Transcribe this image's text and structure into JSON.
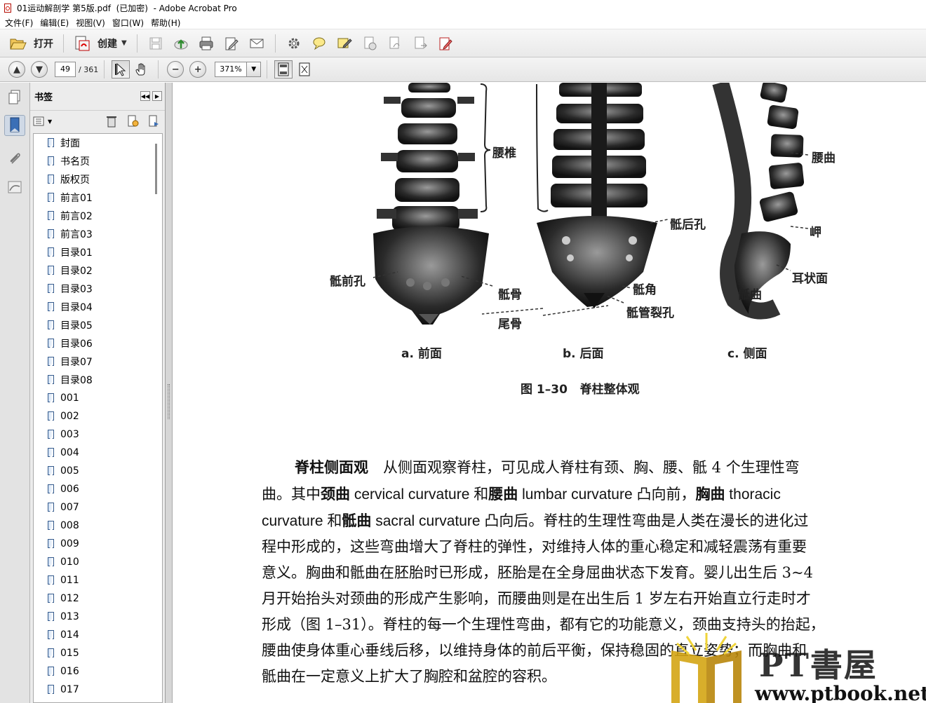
{
  "window": {
    "title": "01运动解剖学 第5版.pdf  (已加密)  - Adobe Acrobat Pro"
  },
  "menu": [
    "文件(F)",
    "编辑(E)",
    "视图(V)",
    "窗口(W)",
    "帮助(H)"
  ],
  "toolbar": {
    "open_label": "打开",
    "create_label": "创建",
    "page_current": "49",
    "page_total": "/ 361",
    "zoom": "371%"
  },
  "bookmarks": {
    "title": "书签",
    "items": [
      "封面",
      "书名页",
      "版权页",
      "前言01",
      "前言02",
      "前言03",
      "目录01",
      "目录02",
      "目录03",
      "目录04",
      "目录05",
      "目录06",
      "目录07",
      "目录08",
      "001",
      "002",
      "003",
      "004",
      "005",
      "006",
      "007",
      "008",
      "009",
      "010",
      "011",
      "012",
      "013",
      "014",
      "015",
      "016",
      "017"
    ]
  },
  "figure": {
    "labels": {
      "lumbar": "腰椎",
      "lumbar_curve": "腰曲",
      "sacral_post_foramen": "骶后孔",
      "promontory": "岬",
      "sacral_ant_foramen": "骶前孔",
      "auricular": "耳状面",
      "sacrum": "骶骨",
      "sacral_horn": "骶角",
      "sacral_curve": "骶曲",
      "sacral_hiatus": "骶管裂孔",
      "coccyx": "尾骨"
    },
    "sub_a": "a. 前面",
    "sub_b": "b. 后面",
    "sub_c": "c. 侧面",
    "caption": "图 1–30   脊柱整体观"
  },
  "body": {
    "l1_bold": "脊柱侧面观",
    "l1_rest": "　从侧面观察脊柱，可见成人脊柱有颈、胸、腰、骶 4 个生理性弯",
    "l2_a": "曲。其中",
    "l2_b": "颈曲",
    "l2_c": " cervical curvature 和",
    "l2_d": "腰曲",
    "l2_e": " lumbar curvature 凸向前，",
    "l2_f": "胸曲",
    "l2_g": " thoracic",
    "l3_a": "curvature 和",
    "l3_b": "骶曲",
    "l3_c": " sacral curvature 凸向后。脊柱的生理性弯曲是人类在漫长的进化过",
    "l4": "程中形成的，这些弯曲增大了脊柱的弹性，对维持人体的重心稳定和减轻震荡有重要",
    "l5": "意义。胸曲和骶曲在胚胎时已形成，胚胎是在全身屈曲状态下发育。婴儿出生后 3~4",
    "l6": "月开始抬头对颈曲的形成产生影响，而腰曲则是在出生后 1 岁左右开始直立行走时才",
    "l7": "形成（图 1–31）。脊柱的每一个生理性弯曲，都有它的功能意义，颈曲支持头的抬起，",
    "l8": "腰曲使身体重心垂线后移，以维持身体的前后平衡，保持稳固的直立姿势；而胸曲和",
    "l9": "骶曲在一定意义上扩大了胸腔和盆腔的容积。"
  },
  "watermark": {
    "text": "PT書屋",
    "url": "www.ptbook.net"
  }
}
